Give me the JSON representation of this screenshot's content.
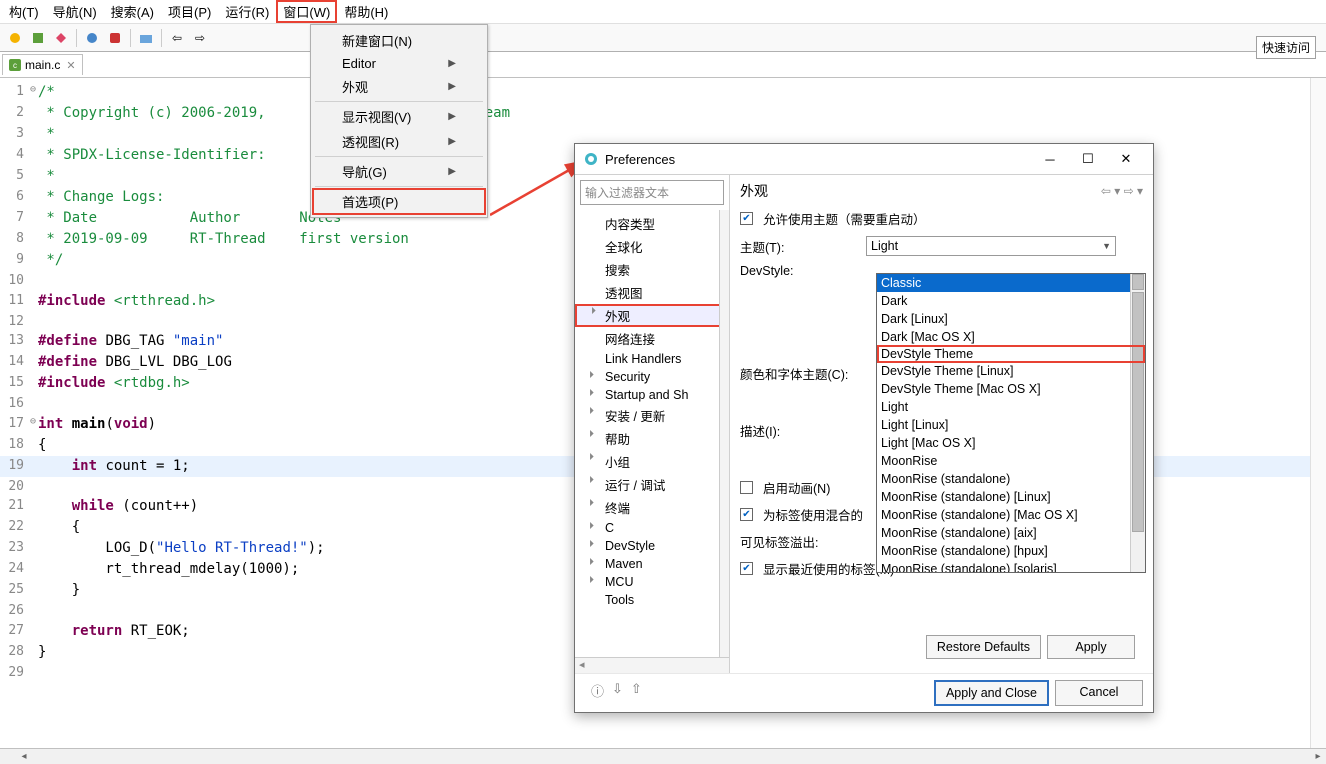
{
  "menubar": [
    "构(T)",
    "导航(N)",
    "搜索(A)",
    "项目(P)",
    "运行(R)",
    "窗口(W)",
    "帮助(H)"
  ],
  "menubar_highlight_index": 5,
  "quick_access": "快速访问",
  "tab": {
    "label": "main.c",
    "close": "✕"
  },
  "dropdown": {
    "items": [
      {
        "t": "新建窗口(N)"
      },
      {
        "t": "Editor",
        "sub": true
      },
      {
        "t": "外观",
        "sub": true
      },
      {
        "sep": true
      },
      {
        "t": "显示视图(V)",
        "sub": true
      },
      {
        "t": "透视图(R)",
        "sub": true
      },
      {
        "sep": true
      },
      {
        "t": "导航(G)",
        "sub": true
      },
      {
        "sep": true
      },
      {
        "t": "首选项(P)",
        "hl": true
      }
    ]
  },
  "code": [
    {
      "n": 1,
      "fold": "⊖",
      "seg": [
        {
          "c": "c-comment",
          "t": "/*"
        }
      ]
    },
    {
      "n": 2,
      "seg": [
        {
          "c": "c-comment",
          "t": " * Copyright (c) 2006-2019,                     ent Team"
        }
      ]
    },
    {
      "n": 3,
      "seg": [
        {
          "c": "c-comment",
          "t": " *"
        }
      ]
    },
    {
      "n": 4,
      "seg": [
        {
          "c": "c-comment",
          "t": " * SPDX-License-Identifier:"
        }
      ]
    },
    {
      "n": 5,
      "seg": [
        {
          "c": "c-comment",
          "t": " *"
        }
      ]
    },
    {
      "n": 6,
      "seg": [
        {
          "c": "c-comment",
          "t": " * Change Logs:"
        }
      ]
    },
    {
      "n": 7,
      "seg": [
        {
          "c": "c-comment",
          "t": " * Date           Author       Notes"
        }
      ]
    },
    {
      "n": 8,
      "seg": [
        {
          "c": "c-comment",
          "t": " * 2019-09-09     RT-Thread    first version"
        }
      ]
    },
    {
      "n": 9,
      "seg": [
        {
          "c": "c-comment",
          "t": " */"
        }
      ]
    },
    {
      "n": 10,
      "seg": [
        {
          "t": ""
        }
      ]
    },
    {
      "n": 11,
      "seg": [
        {
          "c": "c-pp",
          "t": "#include"
        },
        {
          "t": " "
        },
        {
          "c": "c-inc",
          "t": "<rtthread.h>"
        }
      ]
    },
    {
      "n": 12,
      "seg": [
        {
          "t": ""
        }
      ]
    },
    {
      "n": 13,
      "seg": [
        {
          "c": "c-pp",
          "t": "#define"
        },
        {
          "t": " DBG_TAG "
        },
        {
          "c": "c-str",
          "t": "\"main\""
        }
      ]
    },
    {
      "n": 14,
      "seg": [
        {
          "c": "c-pp",
          "t": "#define"
        },
        {
          "t": " DBG_LVL DBG_LOG"
        }
      ]
    },
    {
      "n": 15,
      "seg": [
        {
          "c": "c-pp",
          "t": "#include"
        },
        {
          "t": " "
        },
        {
          "c": "c-inc",
          "t": "<rtdbg.h>"
        }
      ]
    },
    {
      "n": 16,
      "seg": [
        {
          "t": ""
        }
      ]
    },
    {
      "n": 17,
      "fold": "⊖",
      "seg": [
        {
          "c": "c-kw",
          "t": "int"
        },
        {
          "t": " "
        },
        {
          "c": "",
          "t": "main"
        },
        {
          "t": "("
        },
        {
          "c": "c-kw",
          "t": "void"
        },
        {
          "t": ")"
        }
      ],
      "bold_main": true
    },
    {
      "n": 18,
      "seg": [
        {
          "t": "{"
        }
      ]
    },
    {
      "n": 19,
      "cur": true,
      "seg": [
        {
          "t": "    "
        },
        {
          "c": "c-kw",
          "t": "int"
        },
        {
          "t": " count = 1;"
        }
      ]
    },
    {
      "n": 20,
      "seg": [
        {
          "t": ""
        }
      ]
    },
    {
      "n": 21,
      "seg": [
        {
          "t": "    "
        },
        {
          "c": "c-kw",
          "t": "while"
        },
        {
          "t": " (count++)"
        }
      ]
    },
    {
      "n": 22,
      "seg": [
        {
          "t": "    {"
        }
      ]
    },
    {
      "n": 23,
      "seg": [
        {
          "t": "        LOG_D("
        },
        {
          "c": "c-str",
          "t": "\"Hello RT-Thread!\""
        },
        {
          "t": ");"
        }
      ]
    },
    {
      "n": 24,
      "seg": [
        {
          "t": "        rt_thread_mdelay(1000);"
        }
      ]
    },
    {
      "n": 25,
      "seg": [
        {
          "t": "    }"
        }
      ]
    },
    {
      "n": 26,
      "seg": [
        {
          "t": ""
        }
      ]
    },
    {
      "n": 27,
      "seg": [
        {
          "t": "    "
        },
        {
          "c": "c-kw",
          "t": "return"
        },
        {
          "t": " RT_EOK;"
        }
      ]
    },
    {
      "n": 28,
      "seg": [
        {
          "t": "}"
        }
      ]
    },
    {
      "n": 29,
      "seg": [
        {
          "t": ""
        }
      ]
    }
  ],
  "prefs": {
    "title": "Preferences",
    "filter_ph": "输入过滤器文本",
    "tree": [
      {
        "t": "内容类型"
      },
      {
        "t": "全球化"
      },
      {
        "t": "搜索"
      },
      {
        "t": "透视图"
      },
      {
        "t": "外观",
        "exp": true,
        "hl": true
      },
      {
        "t": "网络连接"
      },
      {
        "t": "Link Handlers"
      },
      {
        "t": "Security",
        "exp": true
      },
      {
        "t": "Startup and Sh",
        "exp": true
      },
      {
        "t": "安装 / 更新",
        "exp": true
      },
      {
        "t": "帮助",
        "exp": true
      },
      {
        "t": "小组",
        "exp": true
      },
      {
        "t": "运行 / 调试",
        "exp": true
      },
      {
        "t": "终端",
        "exp": true
      },
      {
        "t": "C",
        "exp": true
      },
      {
        "t": "DevStyle",
        "exp": true
      },
      {
        "t": "Maven",
        "exp": true
      },
      {
        "t": "MCU",
        "exp": true
      },
      {
        "t": "Tools"
      }
    ],
    "heading": "外观",
    "rows": {
      "allow_theme": {
        "chk": true,
        "label": "允许使用主题（需要重启动）"
      },
      "theme_label": "主题(T):",
      "theme_value": "Light",
      "devstyle_label": "DevStyle:",
      "colorscheme_label": "颜色和字体主题(C):",
      "desc_label": "描述(I):",
      "enable_anim": {
        "chk": false,
        "label": "启用动画(N)"
      },
      "mixed_tabs": {
        "chk": true,
        "label": "为标签使用混合的"
      },
      "visible_overflow": "可见标签溢出:",
      "show_recent": {
        "chk": true,
        "label": "显示最近使用的标签(M)"
      }
    },
    "theme_options": [
      {
        "t": "Classic",
        "sel": true
      },
      {
        "t": "Dark"
      },
      {
        "t": "Dark [Linux]"
      },
      {
        "t": "Dark [Mac OS X]"
      },
      {
        "t": "DevStyle Theme",
        "hl": true
      },
      {
        "t": "DevStyle Theme [Linux]"
      },
      {
        "t": "DevStyle Theme [Mac OS X]"
      },
      {
        "t": "Light"
      },
      {
        "t": "Light [Linux]"
      },
      {
        "t": "Light [Mac OS X]"
      },
      {
        "t": "MoonRise"
      },
      {
        "t": "MoonRise (standalone)"
      },
      {
        "t": "MoonRise (standalone) [Linux]"
      },
      {
        "t": "MoonRise (standalone) [Mac OS X]"
      },
      {
        "t": "MoonRise (standalone) [aix]"
      },
      {
        "t": "MoonRise (standalone) [hpux]"
      },
      {
        "t": "MoonRise (standalone) [solaris]"
      }
    ],
    "buttons": {
      "restore": "Restore Defaults",
      "apply": "Apply",
      "apply_close": "Apply and Close",
      "cancel": "Cancel"
    }
  }
}
